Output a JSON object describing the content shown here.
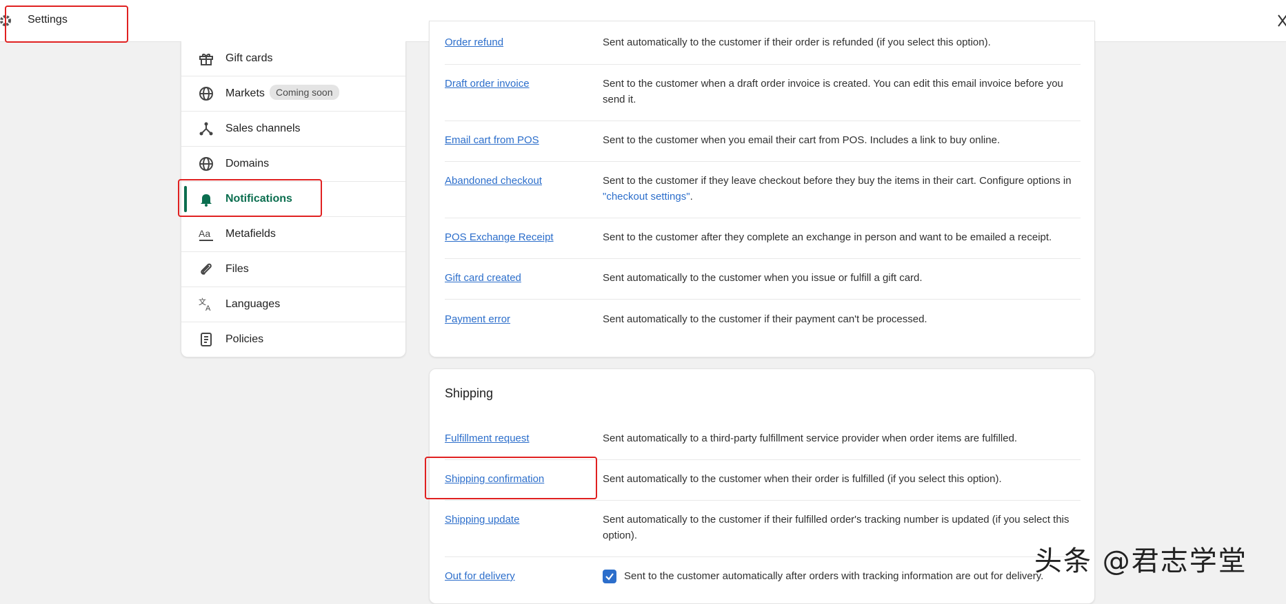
{
  "header": {
    "title": "Settings"
  },
  "sidebar": {
    "items": [
      {
        "label": "Gift cards"
      },
      {
        "label": "Markets",
        "badge": "Coming soon"
      },
      {
        "label": "Sales channels"
      },
      {
        "label": "Domains"
      },
      {
        "label": "Notifications",
        "active": true
      },
      {
        "label": "Metafields"
      },
      {
        "label": "Files"
      },
      {
        "label": "Languages"
      },
      {
        "label": "Policies"
      }
    ]
  },
  "orders_section": {
    "rows": [
      {
        "link": "Order refund",
        "desc": "Sent automatically to the customer if their order is refunded (if you select this option)."
      },
      {
        "link": "Draft order invoice",
        "desc": "Sent to the customer when a draft order invoice is created. You can edit this email invoice before you send it."
      },
      {
        "link": "Email cart from POS",
        "desc": "Sent to the customer when you email their cart from POS. Includes a link to buy online."
      },
      {
        "link": "Abandoned checkout",
        "desc_before": "Sent to the customer if they leave checkout before they buy the items in their cart. Configure options in ",
        "desc_link": "\"checkout settings\"",
        "desc_after": "."
      },
      {
        "link": "POS Exchange Receipt",
        "desc": "Sent to the customer after they complete an exchange in person and want to be emailed a receipt."
      },
      {
        "link": "Gift card created",
        "desc": "Sent automatically to the customer when you issue or fulfill a gift card."
      },
      {
        "link": "Payment error",
        "desc": "Sent automatically to the customer if their payment can't be processed."
      }
    ]
  },
  "shipping_section": {
    "title": "Shipping",
    "rows": [
      {
        "link": "Fulfillment request",
        "desc": "Sent automatically to a third-party fulfillment service provider when order items are fulfilled."
      },
      {
        "link": "Shipping confirmation",
        "desc": "Sent automatically to the customer when their order is fulfilled (if you select this option)."
      },
      {
        "link": "Shipping update",
        "desc": "Sent automatically to the customer if their fulfilled order's tracking number is updated (if you select this option)."
      },
      {
        "link": "Out for delivery",
        "desc": "Sent to the customer automatically after orders with tracking information are out for delivery.",
        "checked": true
      }
    ]
  },
  "watermark": "头条 @君志学堂",
  "colors": {
    "accent": "#0b6e4f",
    "link": "#2c6ecb",
    "highlight": "#e02020"
  }
}
